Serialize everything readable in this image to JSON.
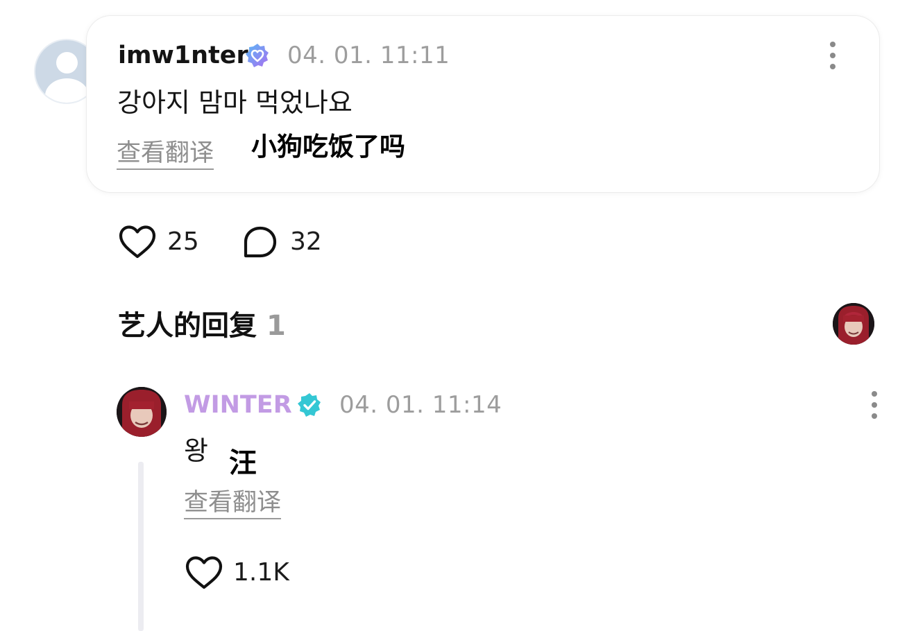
{
  "comment": {
    "username": "imw1nter",
    "timestamp": "04. 01. 11:11",
    "text": "강아지 맘마 먹었나요",
    "translate_label": "查看翻译",
    "caption": "小狗吃饭了吗",
    "likes": "25",
    "replies": "32"
  },
  "artist_section": {
    "title": "艺人的回复",
    "count": "1"
  },
  "reply": {
    "username": "WINTER",
    "timestamp": "04. 01. 11:14",
    "text": "왕",
    "caption": "汪",
    "translate_label": "查看翻译",
    "likes": "1.1K"
  },
  "colors": {
    "artist_name": "#c29be4",
    "fan_badge_gradient": [
      "#5ab8f5",
      "#a86ff0"
    ],
    "artist_badge": "#34c7d4",
    "muted_text": "#9d9d9d"
  },
  "icons": {
    "fan_badge": "verified-heart-badge-icon",
    "artist_badge": "verified-check-badge-icon",
    "more": "kebab-menu-icon",
    "like": "heart-outline-icon",
    "reply": "speech-bubble-icon"
  }
}
